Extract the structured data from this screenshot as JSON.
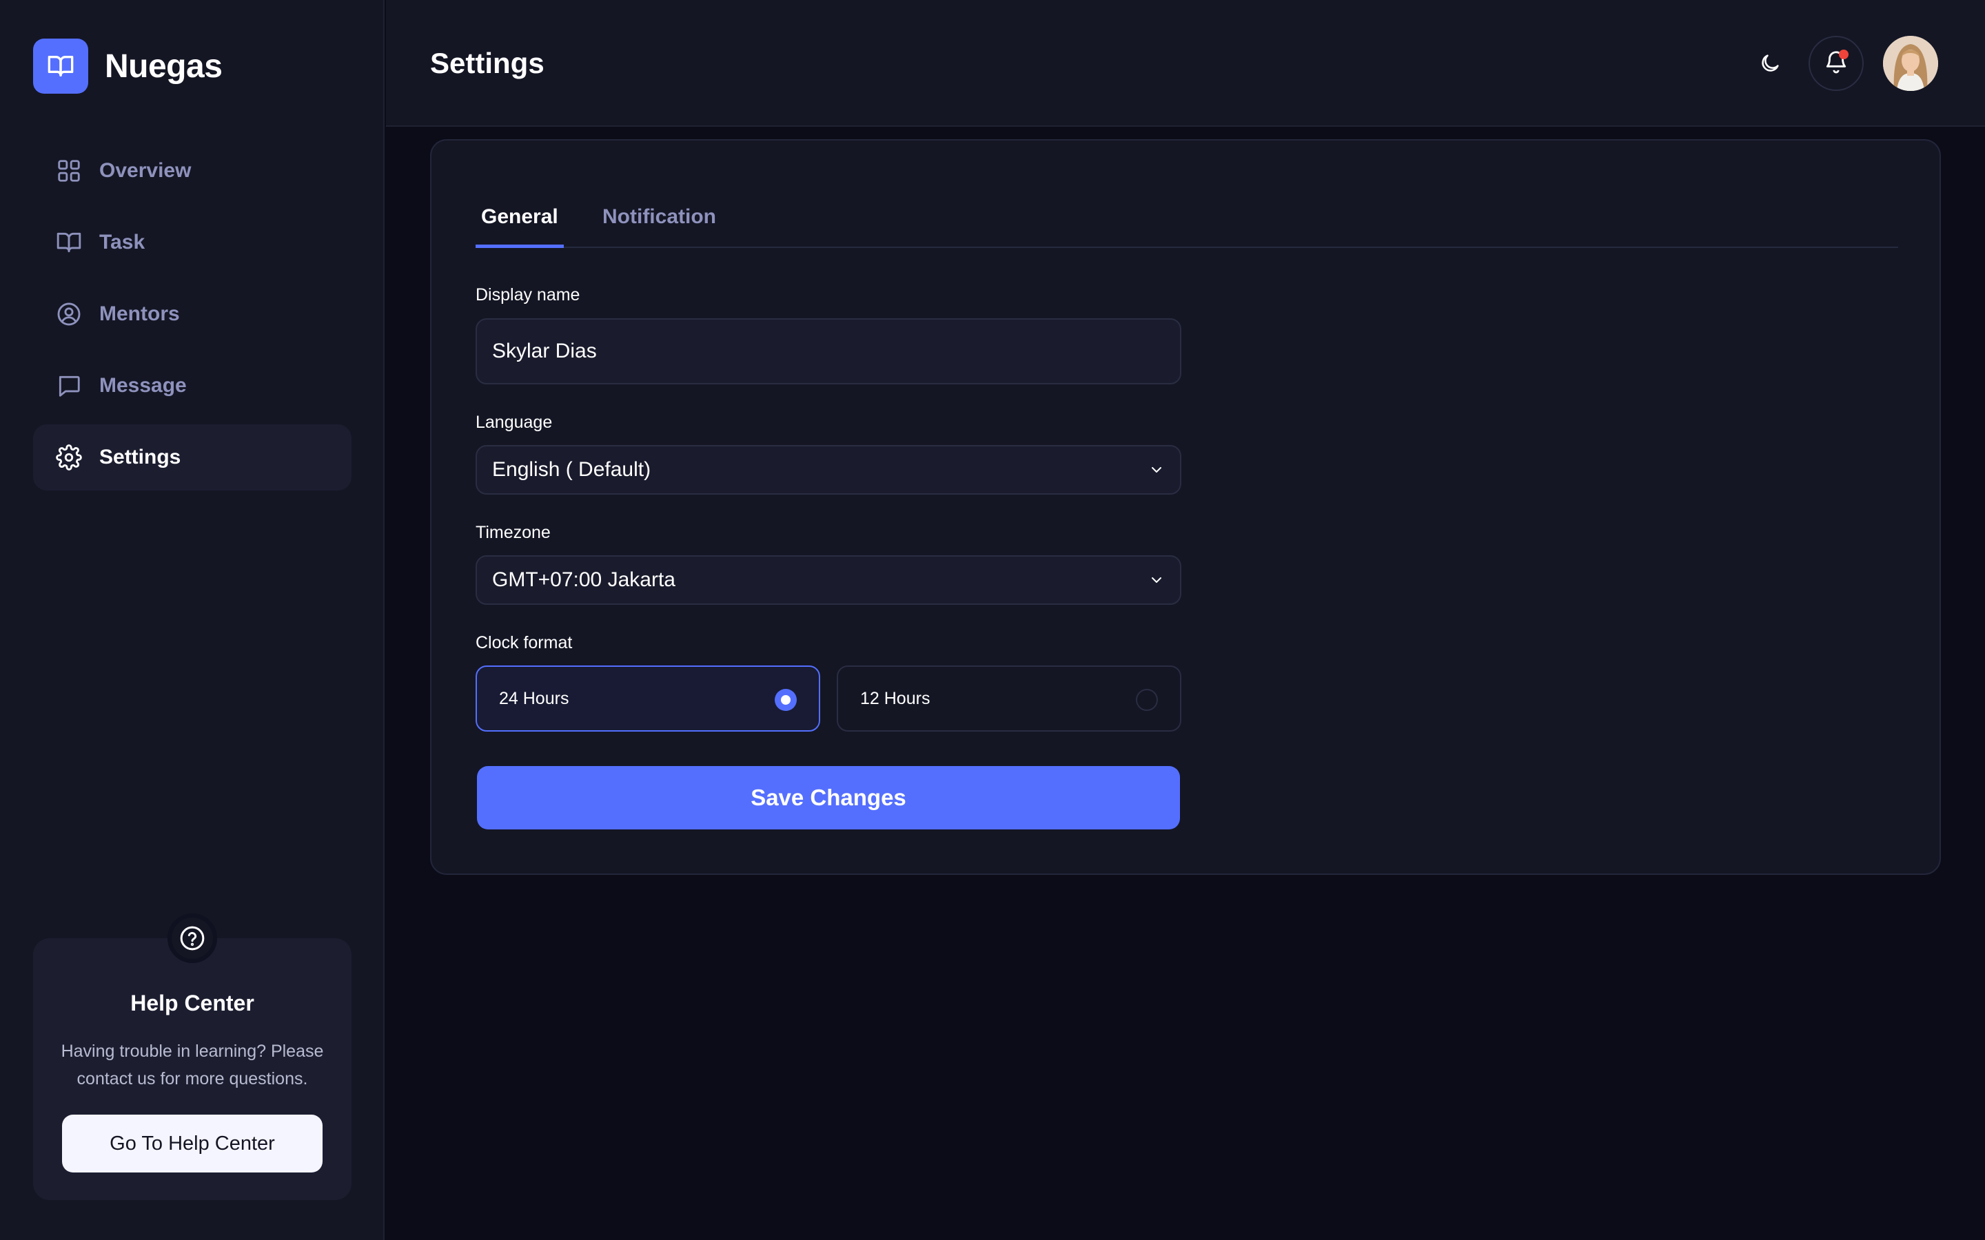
{
  "brand": {
    "name": "Nuegas",
    "accent": "#546ffe"
  },
  "sidebar": {
    "items": [
      {
        "label": "Overview",
        "icon": "grid-icon"
      },
      {
        "label": "Task",
        "icon": "book-icon"
      },
      {
        "label": "Mentors",
        "icon": "user-circle-icon"
      },
      {
        "label": "Message",
        "icon": "chat-icon"
      },
      {
        "label": "Settings",
        "icon": "gear-icon",
        "active": true
      }
    ],
    "help": {
      "title": "Help Center",
      "text": "Having trouble in learning? Please contact us for more questions.",
      "button": "Go To Help Center"
    }
  },
  "header": {
    "title": "Settings",
    "notification_dot_color": "#f0443a"
  },
  "tabs": [
    {
      "label": "General",
      "active": true
    },
    {
      "label": "Notification",
      "active": false
    }
  ],
  "form": {
    "display_name": {
      "label": "Display name",
      "value": "Skylar Dias"
    },
    "language": {
      "label": "Language",
      "value": "English ( Default)"
    },
    "timezone": {
      "label": "Timezone",
      "value": "GMT+07:00 Jakarta"
    },
    "clock_format": {
      "label": "Clock format",
      "options": [
        {
          "label": "24 Hours",
          "selected": true
        },
        {
          "label": "12 Hours",
          "selected": false
        }
      ]
    },
    "save_label": "Save Changes"
  }
}
